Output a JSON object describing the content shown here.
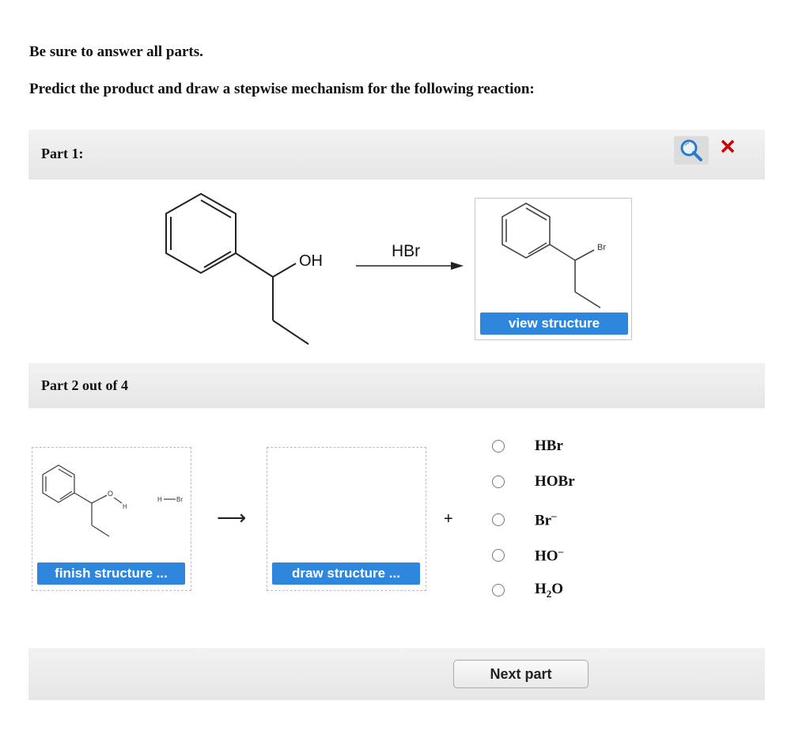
{
  "instructions": {
    "line1": "Be sure to answer all parts.",
    "line2": "Predict the product and draw a stepwise mechanism for the following reaction:"
  },
  "part1": {
    "label": "Part 1:",
    "reagent": "HBr",
    "reactant_group": "OH",
    "product_atom": "Br",
    "view_button": "view structure",
    "icons": {
      "zoom": "magnifier-icon",
      "close": "close-x-icon",
      "close_color": "#cc0000"
    }
  },
  "part2": {
    "label": "Part 2 out of 4",
    "box1": {
      "atom_o": "O",
      "atom_h": "H",
      "hbr_h": "H",
      "hbr_br": "Br",
      "button": "finish structure ..."
    },
    "arrow": "⟶",
    "box2": {
      "button": "draw structure ..."
    },
    "plus": "+",
    "options": [
      {
        "main": "HBr",
        "sub": "",
        "sup": ""
      },
      {
        "main": "HOBr",
        "sub": "",
        "sup": ""
      },
      {
        "main": "Br",
        "sub": "",
        "sup": "–"
      },
      {
        "main": "HO",
        "sub": "",
        "sup": "–"
      },
      {
        "main": "H",
        "sub": "2",
        "tail": "O",
        "sup": ""
      }
    ]
  },
  "footer": {
    "next_button": "Next part"
  },
  "colors": {
    "accent": "#2f86dd",
    "part_bar": "#eaeaea"
  }
}
